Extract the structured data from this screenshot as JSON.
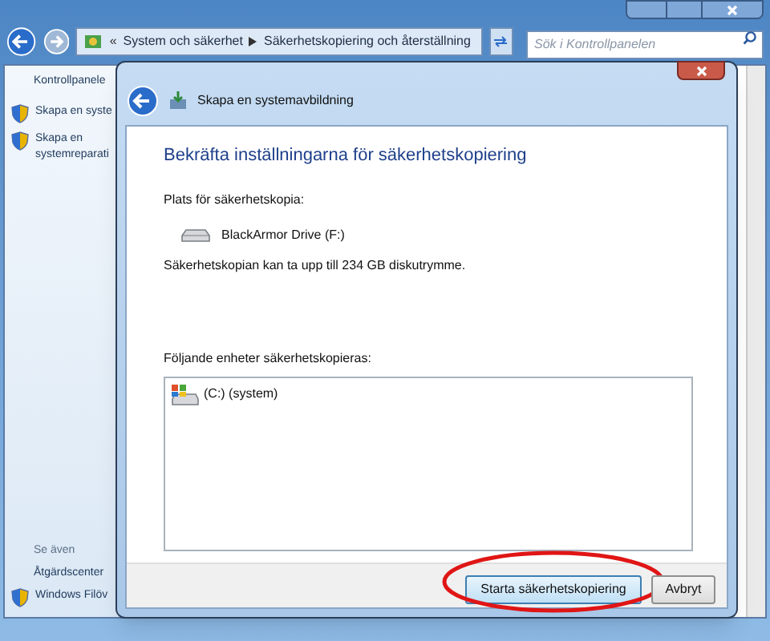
{
  "window": {
    "breadcrumb_separator": "«",
    "breadcrumbs": [
      "System och säkerhet",
      "Säkerhetskopiering och återställning"
    ],
    "search": {
      "placeholder": "Sök i Kontrollpanelen"
    }
  },
  "sidebar": {
    "items": [
      {
        "kind": "home",
        "lines": [
          "Kontrollpanele"
        ]
      },
      {
        "kind": "shield",
        "lines": [
          "Skapa en syste"
        ]
      },
      {
        "kind": "shield",
        "lines": [
          "Skapa en",
          "systemreparati"
        ]
      }
    ],
    "see_also": {
      "heading": "Se även",
      "items": [
        {
          "kind": "plain",
          "lines": [
            "Åtgärdscenter"
          ]
        },
        {
          "kind": "shield",
          "lines": [
            "Windows Filöv"
          ]
        }
      ]
    }
  },
  "dialog": {
    "title": "Skapa en systemavbildning",
    "heading": "Bekräfta inställningarna för säkerhetskopiering",
    "location_label": "Plats för säkerhetskopia:",
    "drive_name": "BlackArmor Drive (F:)",
    "space_note": "Säkerhetskopian kan ta upp till 234 GB diskutrymme.",
    "list_label": "Följande enheter säkerhetskopieras:",
    "drives": [
      {
        "name": "(C:) (system)"
      }
    ],
    "buttons": [
      {
        "label": "Starta säkerhetskopiering",
        "kind": "primary",
        "highlighted": true
      },
      {
        "label": "Avbryt",
        "kind": "cancel",
        "highlighted": false
      }
    ]
  }
}
